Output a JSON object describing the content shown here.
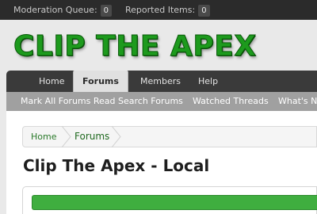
{
  "moderation_bar": {
    "queue_label": "Moderation Queue:",
    "queue_count": "0",
    "reported_label": "Reported Items:",
    "reported_count": "0"
  },
  "logo_text": "CLIP THE APEX",
  "nav": {
    "tabs": [
      {
        "label": "Home"
      },
      {
        "label": "Forums"
      },
      {
        "label": "Members"
      },
      {
        "label": "Help"
      }
    ],
    "active_tab": "Forums"
  },
  "subnav": {
    "links": [
      {
        "label": "Mark All Forums Read"
      },
      {
        "label": "Search Forums"
      },
      {
        "label": "Watched Threads"
      },
      {
        "label": "What's New"
      }
    ]
  },
  "breadcrumb": {
    "items": [
      {
        "label": "Home"
      },
      {
        "label": "Forums"
      }
    ]
  },
  "page_title": "Clip The Apex - Local",
  "colors": {
    "brand_green": "#1d9a1d",
    "forum_bar": "#3fae3f",
    "link_green": "#2a7a2a"
  }
}
